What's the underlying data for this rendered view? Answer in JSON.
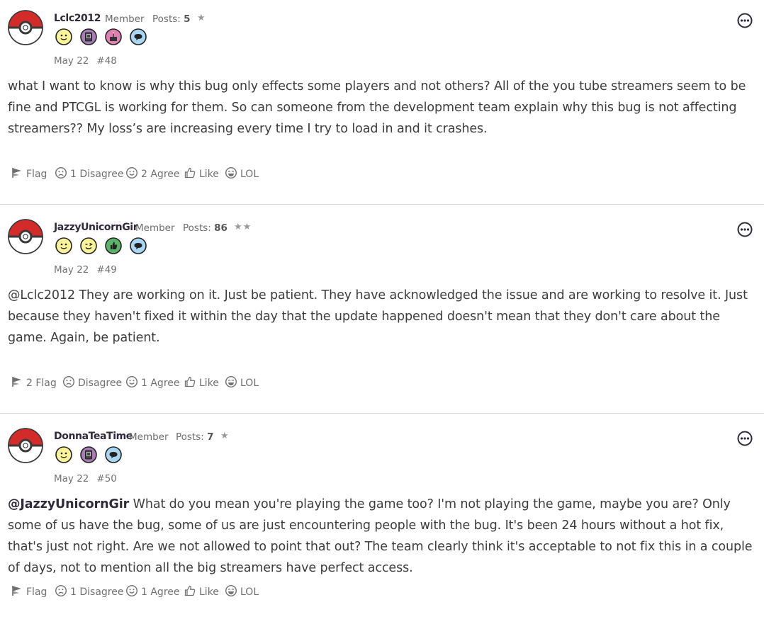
{
  "posts": [
    {
      "username": "Lclc2012",
      "role": "Member",
      "posts_label": "Posts:",
      "posts_count": "5",
      "stars": "★",
      "date": "May 22",
      "number": "#48",
      "text": "what I want to know is why this bug only effects some players and not others? All of the you tube streamers seem to be fine and PTCGL is working for them. So can someone from the development team explain why this bug is not affecting streamers?? My loss’s are increasing every time I try to load in and it crashes.",
      "badges": [
        "smiley-badge-icon",
        "book-badge-icon",
        "cake-badge-icon",
        "speech-badge-icon"
      ],
      "reactions": {
        "flag": "Flag",
        "disagree": "1 Disagree",
        "agree": "2 Agree",
        "like": "Like",
        "lol": "LOL"
      }
    },
    {
      "username": "JazzyUnicornGir",
      "role": "Member",
      "posts_label": "Posts:",
      "posts_count": "86",
      "stars": "★★",
      "date": "May 22",
      "number": "#49",
      "text": "@Lclc2012 They are working on it. Just be patient. They have acknowledged the issue and are working to resolve it. Just because they haven't fixed it within the day that the update happened doesn't mean that they don't care about the game. Again, be patient.",
      "badges": [
        "smiley-badge-icon",
        "wink-badge-icon",
        "thumbs-up-badge-icon",
        "speech-badge-icon"
      ],
      "reactions": {
        "flag": "2 Flag",
        "disagree": "Disagree",
        "agree": "1 Agree",
        "like": "Like",
        "lol": "LOL"
      }
    },
    {
      "username": "DonnaTeaTime",
      "role": "Member",
      "posts_label": "Posts:",
      "posts_count": "7",
      "stars": "★",
      "date": "May 22",
      "number": "#50",
      "mention": "@JazzyUnicornGir",
      "text": " What do you mean you're playing the game too? I'm not playing the game, maybe you are? Only some of us have the bug, some of us are just encountering people with the bug. It's been 24 hours without a hot fix, that's just not right. Are we not allowed to point that out? The team clearly think it's acceptable to not fix this in a couple of days, not to mention all the big streamers have perfect access.",
      "badges": [
        "smiley-badge-icon",
        "book-badge-icon",
        "speech-badge-icon"
      ],
      "reactions": {
        "flag": "Flag",
        "disagree": "1 Disagree",
        "agree": "1 Agree",
        "like": "Like",
        "lol": "LOL"
      }
    }
  ],
  "colors": {
    "pokeball_red": "#d32a2a",
    "username": "#30293a",
    "divider": "#d6d6d6"
  }
}
